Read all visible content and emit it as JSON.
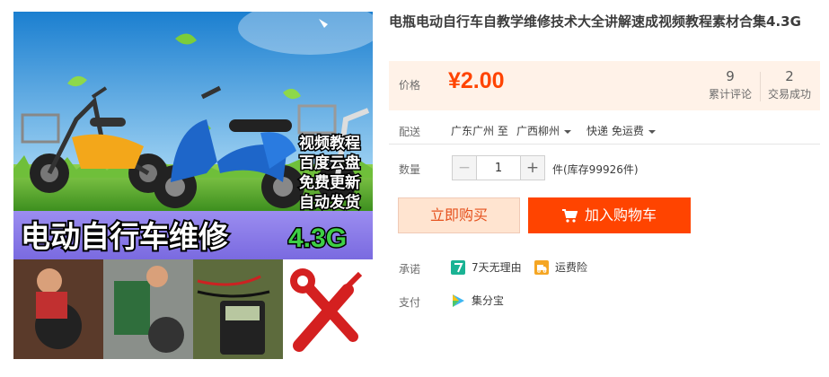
{
  "product": {
    "title": "电瓶电动自行车自教学维修技术大全讲解速成视频教程素材合集4.3G",
    "image": {
      "overlay_lines": [
        "视频教程",
        "百度云盘",
        "免费更新",
        "自动发货"
      ],
      "banner_text": "电动自行车维修",
      "banner_size": "4.3G"
    }
  },
  "price": {
    "label": "价格",
    "value": "¥2.00",
    "reviews_count": "9",
    "reviews_label": "累计评论",
    "deals_count": "2",
    "deals_label": "交易成功"
  },
  "shipping": {
    "label": "配送",
    "from": "广东广州 至",
    "to": "广西柳州",
    "method": "快递 免运费"
  },
  "quantity": {
    "label": "数量",
    "value": "1",
    "minus": "−",
    "plus": "+",
    "stock_text": "件(库存99926件)"
  },
  "actions": {
    "buy_now": "立即购买",
    "add_to_cart": "加入购物车"
  },
  "promise": {
    "label": "承诺",
    "items": [
      {
        "text": "7天无理由",
        "icon": "seven-day-return-icon",
        "color": "#1ab394"
      },
      {
        "text": "运费险",
        "icon": "freight-insurance-icon",
        "color": "#f5a623"
      }
    ]
  },
  "payment": {
    "label": "支付",
    "method": "集分宝",
    "icon": "jifenbao-icon"
  },
  "colors": {
    "accent": "#ff4400",
    "price_bg": "#fff2e8",
    "buy_bg": "#ffe4d0"
  }
}
